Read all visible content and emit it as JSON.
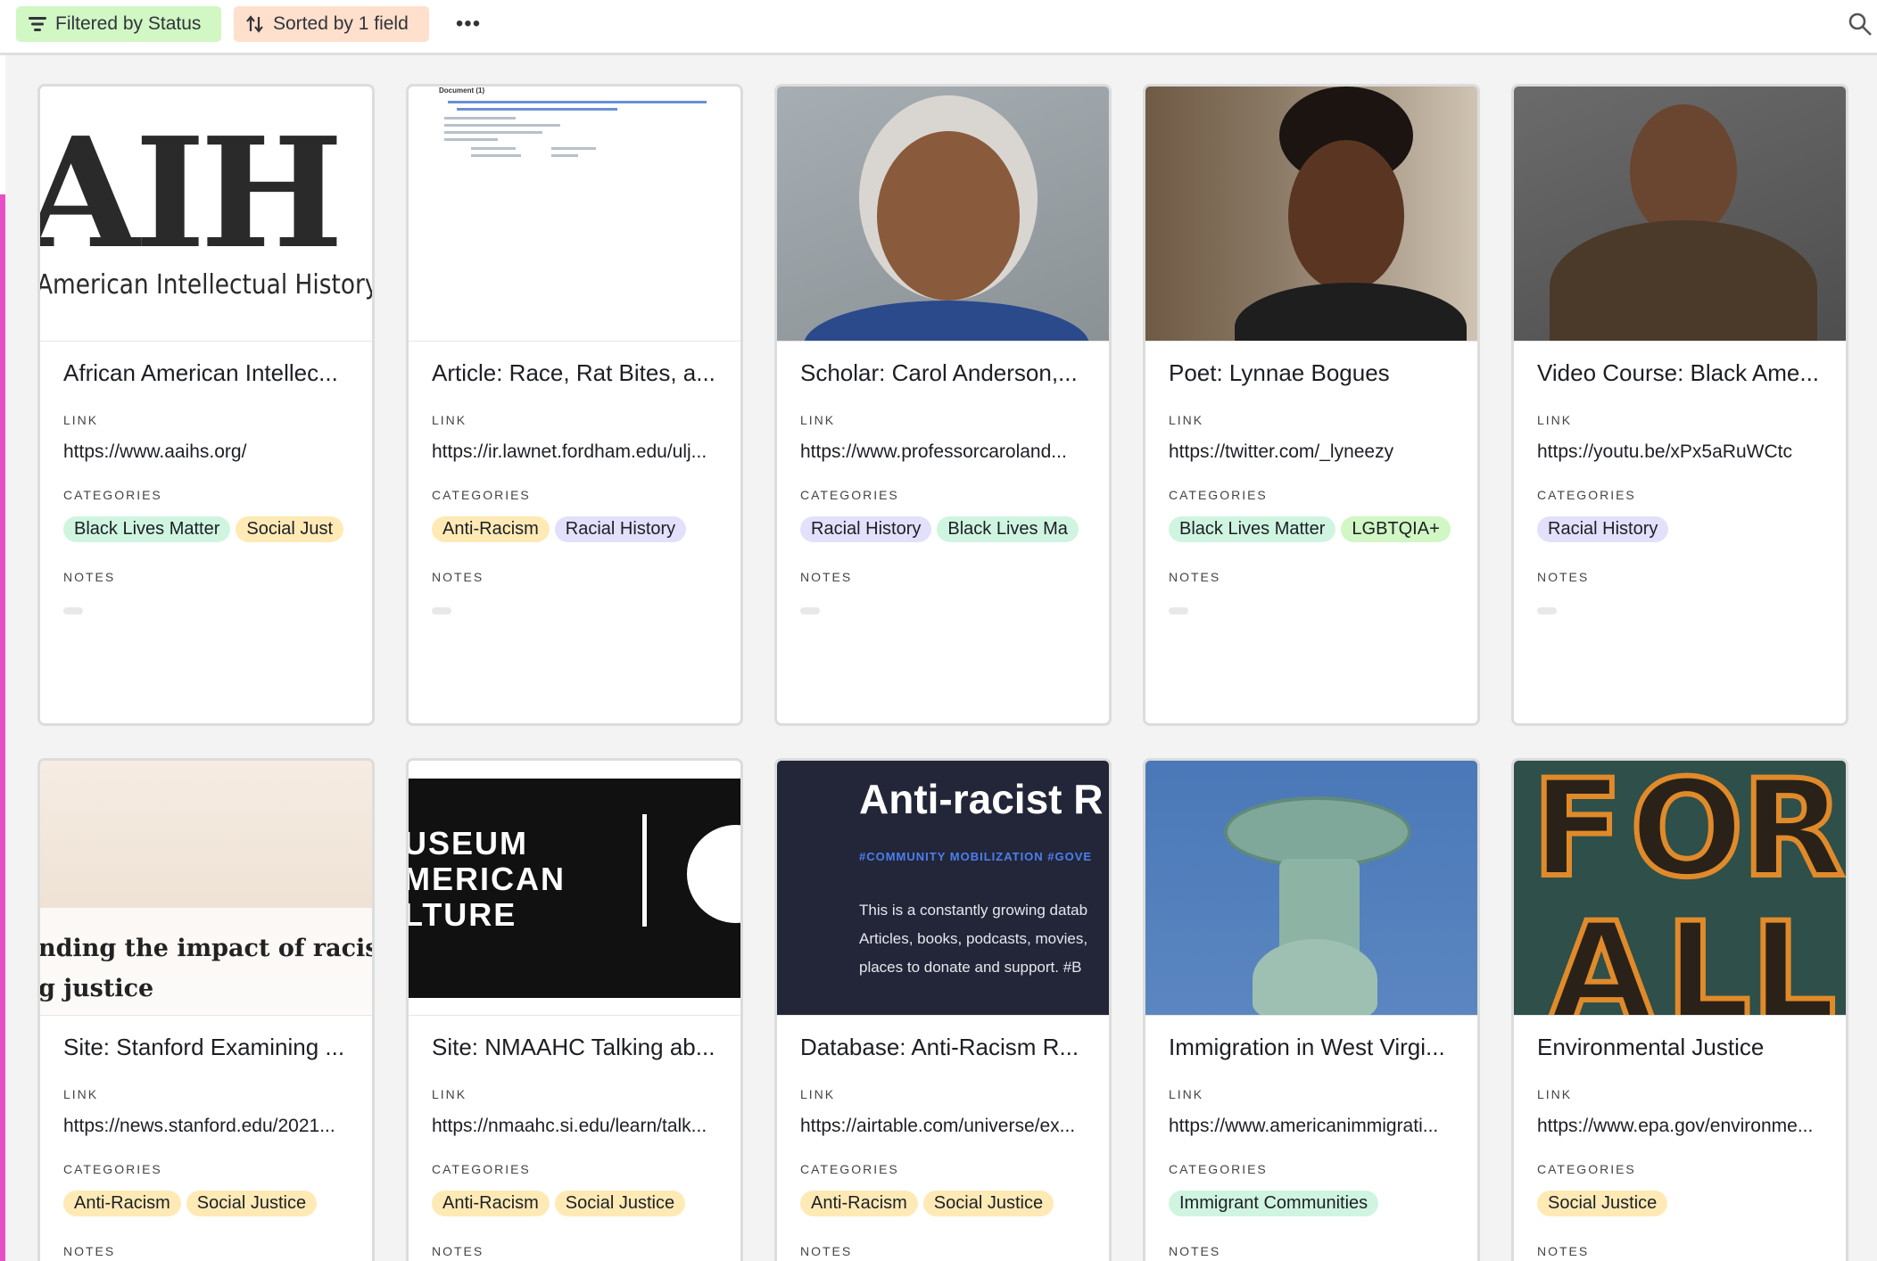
{
  "toolbar": {
    "filter_label": "Filtered by Status",
    "sort_label": "Sorted by 1 field",
    "more_label": "•••"
  },
  "field_labels": {
    "link": "LINK",
    "categories": "CATEGORIES",
    "notes": "NOTES"
  },
  "cards": [
    {
      "title": "African American Intellec...",
      "link": "https://www.aaihs.org/",
      "categories": [
        "Black Lives Matter",
        "Social Just"
      ],
      "cover_text": "AIH",
      "cover_sub": "American Intellectual History"
    },
    {
      "title": "Article: Race, Rat Bites, a...",
      "link": "https://ir.lawnet.fordham.edu/ulj...",
      "categories": [
        "Anti-Racism",
        "Racial History"
      ],
      "cover_text": "Document (1)"
    },
    {
      "title": "Scholar: Carol Anderson,...",
      "link": "https://www.professorcaroland...",
      "categories": [
        "Racial History",
        "Black Lives Ma"
      ]
    },
    {
      "title": "Poet: Lynnae Bogues",
      "link": "https://twitter.com/_lyneezy",
      "categories": [
        "Black Lives Matter",
        "LGBTQIA+"
      ]
    },
    {
      "title": "Video Course: Black Ame...",
      "link": "https://youtu.be/xPx5aRuWCtc",
      "categories": [
        "Racial History"
      ]
    },
    {
      "title": "Site: Stanford Examining ...",
      "link": "https://news.stanford.edu/2021...",
      "categories": [
        "Anti-Racism",
        "Social Justice"
      ],
      "cover_line1": "nding the impact of racism;",
      "cover_line2": "g justice"
    },
    {
      "title": "Site: NMAAHC Talking ab...",
      "link": "https://nmaahc.si.edu/learn/talk...",
      "categories": [
        "Anti-Racism",
        "Social Justice"
      ],
      "cover_text": "USEUM\nMERICAN\nLTURE"
    },
    {
      "title": "Database: Anti-Racism R...",
      "link": "https://airtable.com/universe/ex...",
      "categories": [
        "Anti-Racism",
        "Social Justice"
      ],
      "cover_heading": "Anti-racist R",
      "cover_tagline": "#COMMUNITY MOBILIZATION   #GOVE",
      "cover_para": "This is a constantly growing datab\nArticles, books, podcasts, movies,\nplaces to donate and support. #B"
    },
    {
      "title": "Immigration in West Virgi...",
      "link": "https://www.americanimmigrati...",
      "categories": [
        "Immigrant Communities"
      ]
    },
    {
      "title": "Environmental Justice",
      "link": "https://www.epa.gov/environme...",
      "categories": [
        "Social Justice"
      ],
      "cover_text": "FOR ALL"
    }
  ],
  "tag_colors": {
    "Black Lives Matter": "#cff5e1",
    "Social Justice": "#ffeab6",
    "Anti-Racism": "#ffeab6",
    "Racial History": "#e3e0fb",
    "LGBTQIA+": "#d1f7c4",
    "Immigrant Communities": "#cff5e1"
  }
}
